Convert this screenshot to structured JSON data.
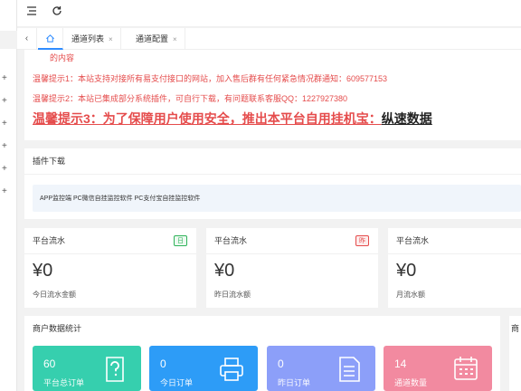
{
  "tabs": {
    "home_icon": "home-icon",
    "items": [
      {
        "label": "通道列表",
        "close": "×"
      },
      {
        "label": "通道配置",
        "close": "×"
      }
    ]
  },
  "notice": {
    "line0": "的内容",
    "line1": "温馨提示1：本站支持对接所有易支付接口的网站，加入售后群有任何紧急情况群通知：609577153",
    "line2": "温馨提示2：本站已集成部分系统插件，可自行下载，有问题联系客服QQ：1227927380",
    "line3_red": "温馨提示3：为了保障用户使用安全，推出本平台自用挂机宝：",
    "line3_black": "纵速数据"
  },
  "plugin": {
    "title": "插件下载",
    "links": "APP监控端 PC微信自挂监控软件 PC支付宝自挂监控软件"
  },
  "stats": [
    {
      "title": "平台流水",
      "badge": "日",
      "amount": "¥0",
      "sub": "今日流水金额",
      "badge_color": "#2fb35a"
    },
    {
      "title": "平台流水",
      "badge": "昨",
      "amount": "¥0",
      "sub": "昨日流水额",
      "badge_color": "#e54c4c"
    },
    {
      "title": "平台流水",
      "badge": "",
      "amount": "¥0",
      "sub": "月流水额"
    }
  ],
  "merchant": {
    "title": "商户数据统计",
    "side_title": "商",
    "tiles": [
      {
        "value": "60",
        "label": "平台总订单",
        "icon": "help-doc-icon",
        "color": "#36cfae"
      },
      {
        "value": "0",
        "label": "今日订单",
        "icon": "printer-icon",
        "color": "#2d9cf7"
      },
      {
        "value": "0",
        "label": "昨日订单",
        "icon": "document-list-icon",
        "color": "#8c9ff9"
      },
      {
        "value": "14",
        "label": "通道数量",
        "icon": "calendar-icon",
        "color": "#f28aa0"
      }
    ]
  }
}
